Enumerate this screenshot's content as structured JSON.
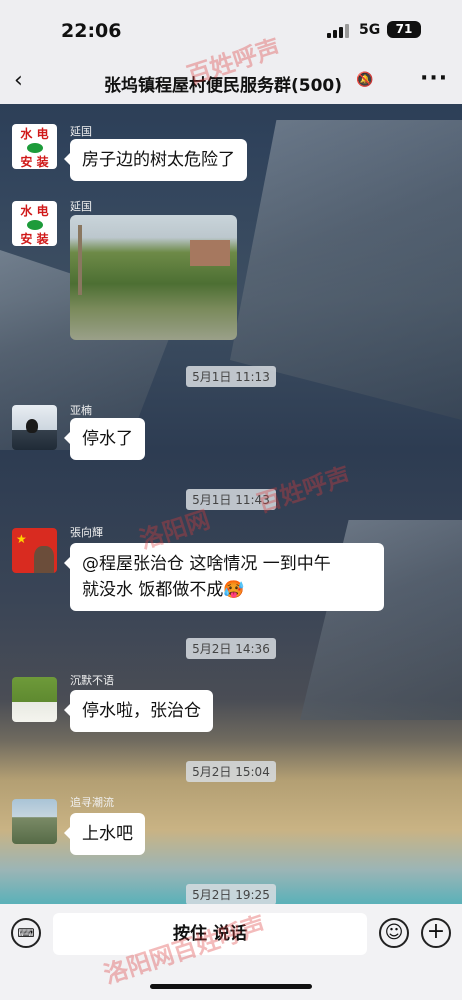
{
  "status": {
    "time": "22:06",
    "network": "5G",
    "battery": "71"
  },
  "nav": {
    "back_icon": "‹",
    "title": "张坞镇程屋村便民服务群(500)",
    "mute_icon": "🔕",
    "more_icon": "···"
  },
  "messages": [
    {
      "name": "延国",
      "text": "房子边的树太危险了"
    },
    {
      "name": "延国"
    },
    {
      "name": "亚楠",
      "text": "停水了"
    },
    {
      "name": "張向輝",
      "text_line1": "@程屋张治仓   这啥情况   一到中午",
      "text_line2": "就没水   饭都做不成🥵"
    },
    {
      "name": "沉默不语",
      "text": "停水啦，张治仓"
    },
    {
      "name": "追寻潮流",
      "text": "上水吧"
    }
  ],
  "avatar_logo": {
    "line1": "水 电",
    "line2": "安 装"
  },
  "timestamps": [
    "5月1日 11:13",
    "5月1日 11:43",
    "5月2日 14:36",
    "5月2日 15:04",
    "5月2日 19:25"
  ],
  "input": {
    "keyboard_icon": "⌨",
    "hold_to_talk": "按住 说话",
    "emoji_icon": "☺",
    "plus_icon": "+"
  },
  "watermarks": [
    "百姓呼声",
    "洛阳网",
    "百姓呼声",
    "洛阳网百姓呼声"
  ]
}
